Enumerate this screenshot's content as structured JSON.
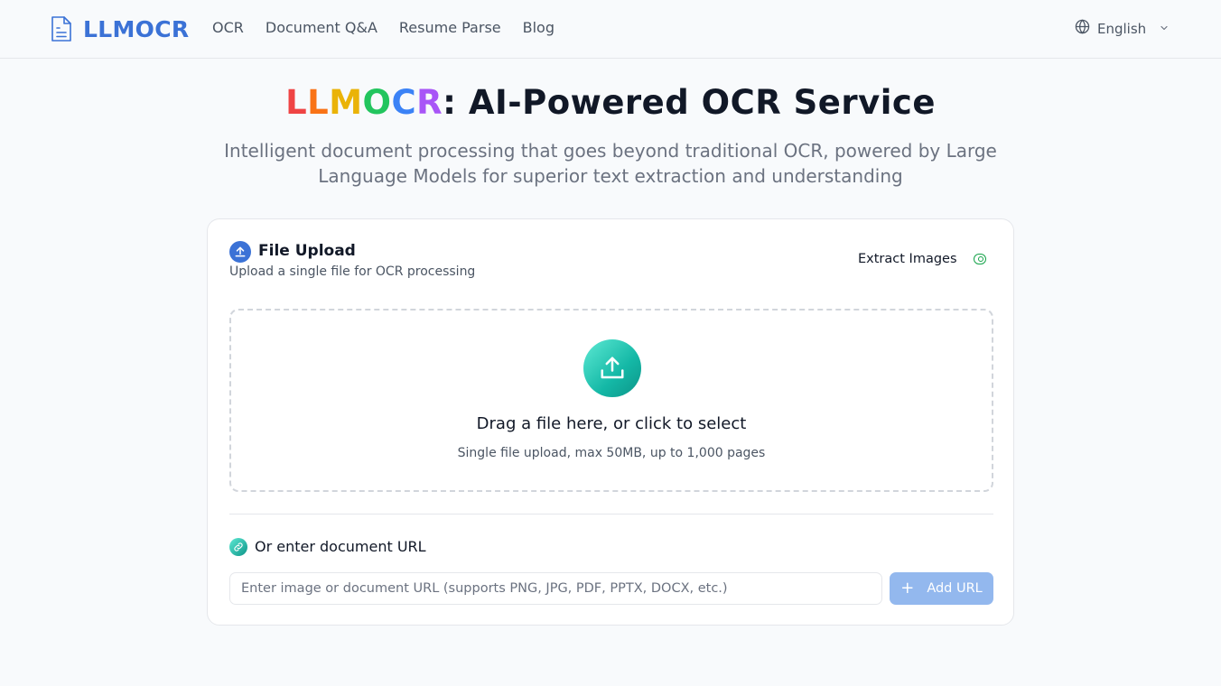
{
  "header": {
    "logo_text": "LLMOCR",
    "nav": [
      "OCR",
      "Document Q&A",
      "Resume Parse",
      "Blog"
    ],
    "language": "English"
  },
  "hero": {
    "title_brand": [
      "L",
      "L",
      "M",
      "O",
      "C",
      "R"
    ],
    "title_rest": ": AI-Powered OCR Service",
    "subtitle": "Intelligent document processing that goes beyond traditional OCR, powered by Large Language Models for superior text extraction and understanding"
  },
  "upload": {
    "title": "File Upload",
    "subtitle": "Upload a single file for OCR processing",
    "extract_images_label": "Extract Images",
    "extract_images_enabled": true,
    "dropzone_title": "Drag a file here, or click to select",
    "dropzone_sub": "Single file upload, max 50MB, up to 1,000 pages"
  },
  "url_section": {
    "title": "Or enter document URL",
    "input_value": "",
    "input_placeholder": "Enter image or document URL (supports PNG, JPG, PDF, PPTX, DOCX, etc.)",
    "add_button": "Add URL"
  },
  "colors": {
    "brand": "#3b72d6",
    "teal": "#14b8a6",
    "button_disabled": "#93b8ee",
    "rainbow": [
      "#ef4444",
      "#f97316",
      "#eab308",
      "#22c55e",
      "#3b82f6",
      "#a855f7"
    ]
  },
  "icons": {
    "logo": "document-icon",
    "language": "globe-icon",
    "language_dropdown": "chevron-down-icon",
    "upload_header": "upload-icon",
    "extract_toggle": "toggle-icon",
    "dropzone": "upload-tray-icon",
    "url": "link-icon",
    "add": "plus-icon"
  }
}
